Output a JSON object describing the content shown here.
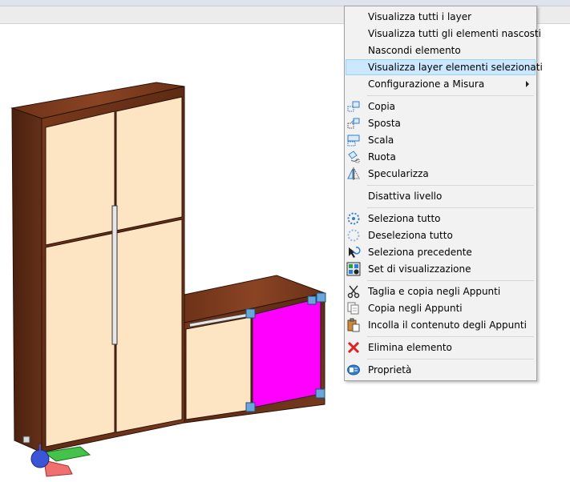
{
  "context_menu": {
    "items": [
      {
        "label": "Visualizza tutti i layer",
        "icon": "none"
      },
      {
        "label": "Visualizza tutti gli elementi nascosti",
        "icon": "none"
      },
      {
        "label": "Nascondi elemento",
        "icon": "none"
      },
      {
        "label": "Visualizza layer elementi selezionati",
        "icon": "none",
        "highlighted": true
      },
      {
        "label": "Configurazione a Misura",
        "icon": "none",
        "submenu": true
      },
      {
        "label": "Copia",
        "icon": "copy-objects-icon"
      },
      {
        "label": "Sposta",
        "icon": "move-icon"
      },
      {
        "label": "Scala",
        "icon": "scale-icon"
      },
      {
        "label": "Ruota",
        "icon": "rotate-icon"
      },
      {
        "label": "Specularizza",
        "icon": "mirror-icon"
      },
      {
        "label": "Disattiva livello",
        "icon": "none"
      },
      {
        "label": "Seleziona tutto",
        "icon": "select-all-icon"
      },
      {
        "label": "Deseleziona tutto",
        "icon": "deselect-all-icon"
      },
      {
        "label": "Seleziona precedente",
        "icon": "select-previous-icon"
      },
      {
        "label": "Set di visualizzazione",
        "icon": "display-set-icon"
      },
      {
        "label": "Taglia e copia negli Appunti",
        "icon": "scissors-icon"
      },
      {
        "label": "Copia negli Appunti",
        "icon": "clipboard-copy-icon"
      },
      {
        "label": "Incolla il contenuto degli Appunti",
        "icon": "paste-icon"
      },
      {
        "label": "Elimina elemento",
        "icon": "delete-x-icon"
      },
      {
        "label": "Proprietà",
        "icon": "properties-icon"
      }
    ]
  },
  "colors": {
    "menu_background": "#f2f2f2",
    "highlight": "#cce8ff",
    "highlight_border": "#99d1ff",
    "wood": "#6b3218",
    "door": "#fde5c4",
    "selected_panel": "#ff00ff",
    "grip": "#6aa6d8"
  }
}
